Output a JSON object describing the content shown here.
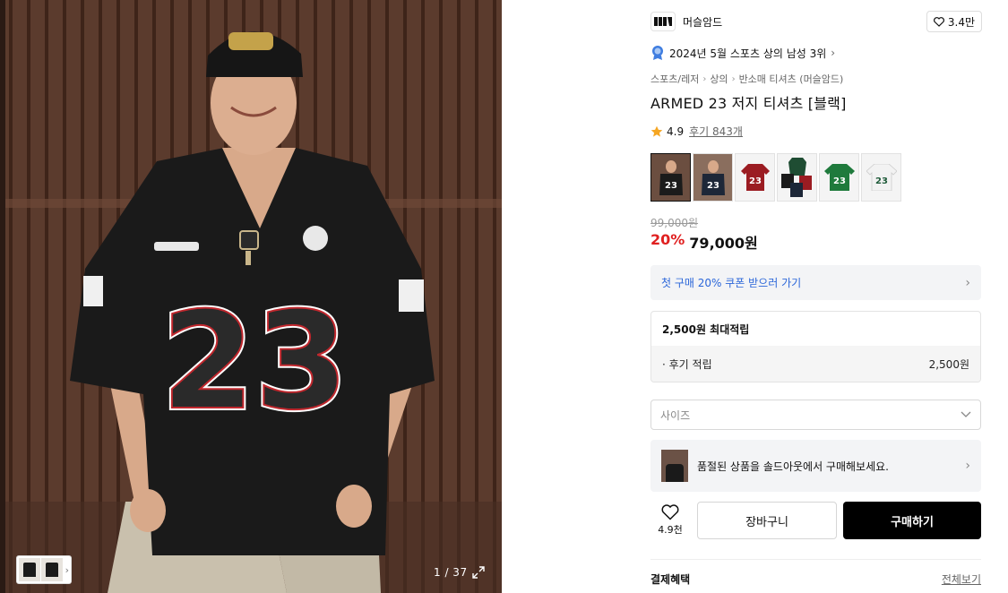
{
  "gallery": {
    "counter": "1 / 37"
  },
  "brand": {
    "name": "머슬암드",
    "likes": "3.4만"
  },
  "ranking": {
    "text": "2024년 5월 스포츠 상의 남성 3위"
  },
  "breadcrumbs": [
    "스포츠/레저",
    "상의",
    "반소매 티셔츠 (머슬암드)"
  ],
  "product": {
    "title": "ARMED 23 저지 티셔츠 [블랙]",
    "rating": "4.9",
    "reviews": "후기 843개",
    "original_price": "99,000원",
    "discount": "20%",
    "price": "79,000원"
  },
  "swatches": [
    {
      "name": "photo-black",
      "color": "#1b1b1b",
      "bg": "#6b4e40"
    },
    {
      "name": "photo-navy",
      "color": "#1d2738",
      "bg": "#8a6e5e"
    },
    {
      "name": "red",
      "color": "#9b1c22",
      "bg": "#f5f5f5"
    },
    {
      "name": "multi",
      "color": "#1f4d33",
      "bg": "#f5f5f5"
    },
    {
      "name": "green",
      "color": "#1f7a3c",
      "bg": "#f5f5f5"
    },
    {
      "name": "white",
      "color": "#f2f2f2",
      "bg": "#f5f5f5"
    }
  ],
  "coupon": {
    "label": "첫 구매 20% 쿠폰 받으러 가기"
  },
  "points": {
    "max": "2,500원 최대적립",
    "row_label": "· 후기 적립",
    "row_value": "2,500원"
  },
  "size": {
    "placeholder": "사이즈"
  },
  "soldout": {
    "text": "품절된 상품을 솔드아웃에서 구매해보세요."
  },
  "actions": {
    "wish_count": "4.9천",
    "cart": "장바구니",
    "buy": "구매하기"
  },
  "benefits": {
    "title": "결제혜택",
    "view_all": "전체보기"
  },
  "colors": {
    "accent_red": "#e02020",
    "coupon_blue": "#2b66d9",
    "star": "#f5a623"
  }
}
